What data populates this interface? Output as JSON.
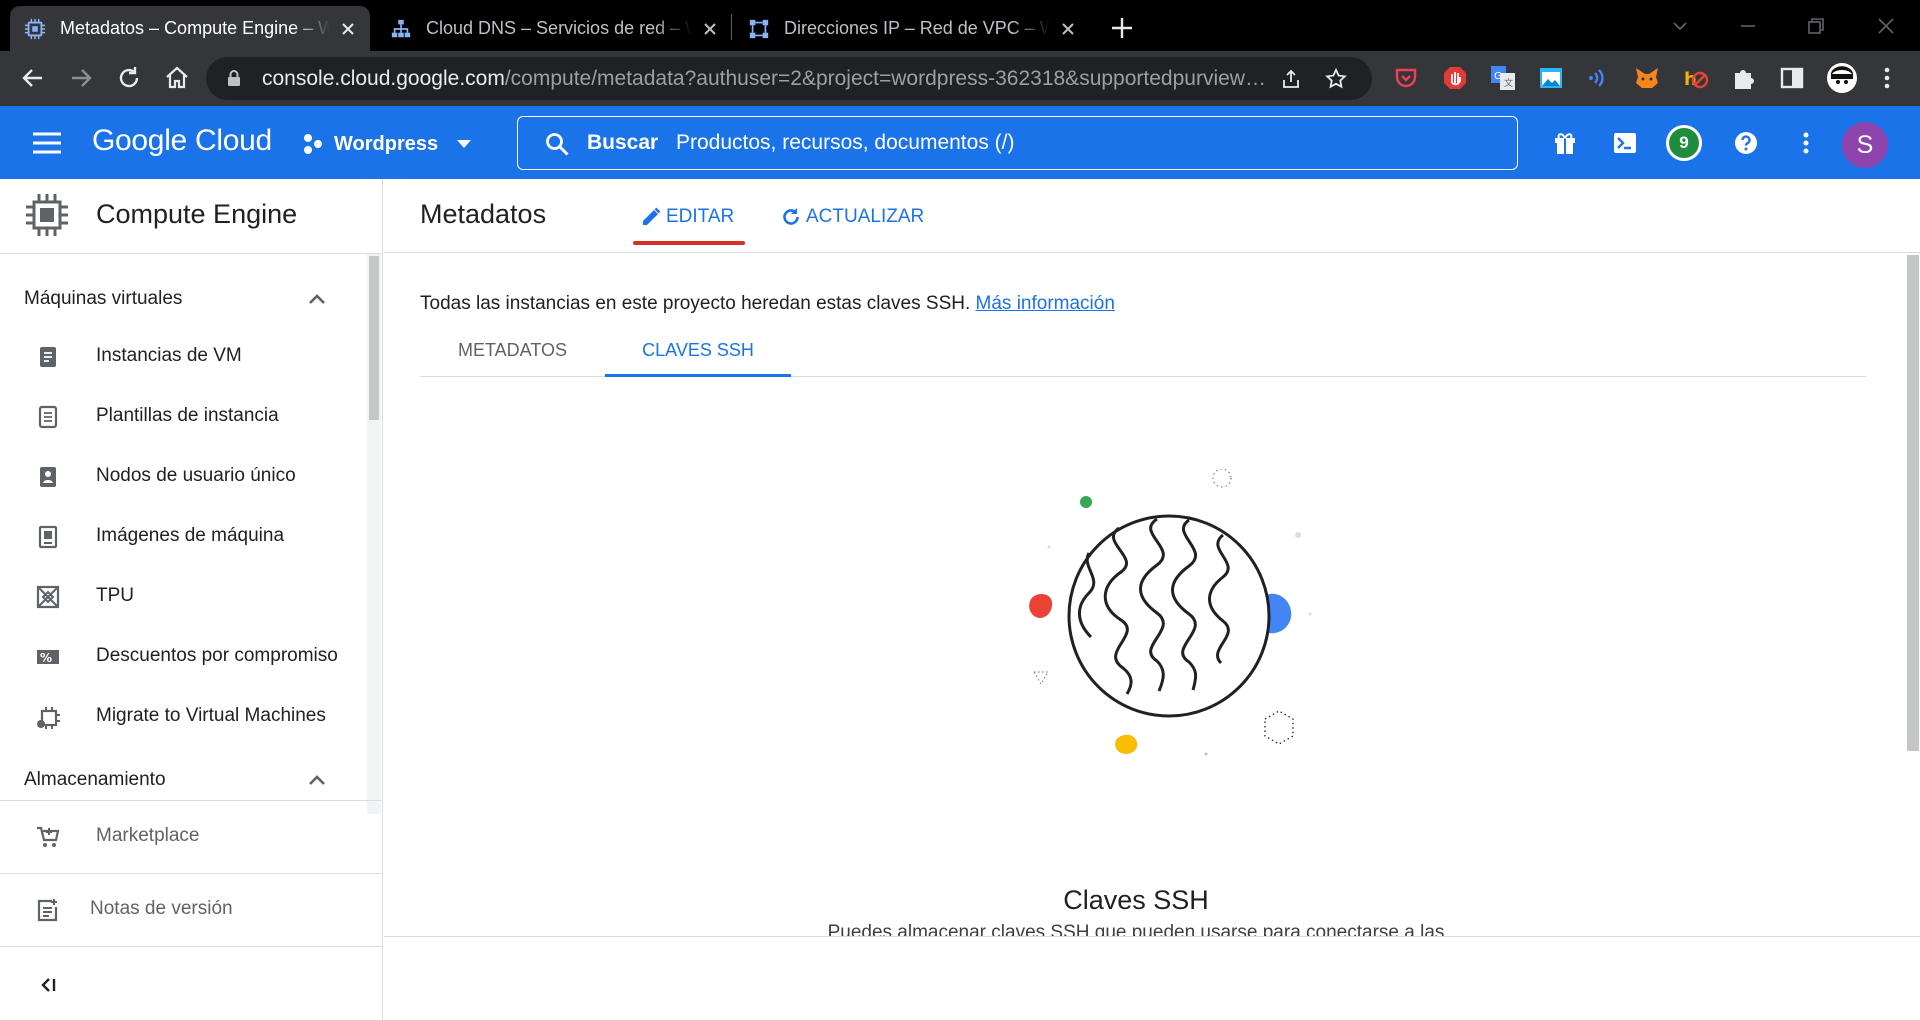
{
  "browser": {
    "tabs": [
      {
        "title": "Metadatos – Compute Engine – Wordpress",
        "active": true
      },
      {
        "title": "Cloud DNS – Servicios de red – Wordpress",
        "active": false
      },
      {
        "title": "Direcciones IP – Red de VPC – Wordpress",
        "active": false
      }
    ],
    "url_host": "console.cloud.google.com",
    "url_path": "/compute/metadata?authuser=2&project=wordpress-362318&supportedpurview=project"
  },
  "header": {
    "logo": "Google Cloud",
    "project": "Wordpress",
    "search_label": "Buscar",
    "search_placeholder": "Productos, recursos, documentos (/)",
    "notification_count": "9",
    "avatar_initial": "S",
    "brand_color": "#1a73e8"
  },
  "sidebar": {
    "product": "Compute Engine",
    "sections": [
      {
        "label": "Máquinas virtuales"
      },
      {
        "label": "Almacenamiento"
      }
    ],
    "items": [
      {
        "label": "Instancias de VM",
        "icon": "vm-instances-icon"
      },
      {
        "label": "Plantillas de instancia",
        "icon": "instance-templates-icon"
      },
      {
        "label": "Nodos de usuario único",
        "icon": "sole-tenant-nodes-icon"
      },
      {
        "label": "Imágenes de máquina",
        "icon": "machine-images-icon"
      },
      {
        "label": "TPU",
        "icon": "tpu-icon"
      },
      {
        "label": "Descuentos por compromiso",
        "icon": "percent-discount-icon"
      },
      {
        "label": "Migrate to Virtual Machines",
        "icon": "migrate-icon"
      }
    ],
    "marketplace": "Marketplace",
    "release_notes": "Notas de versión"
  },
  "main": {
    "title": "Metadatos",
    "edit_label": "EDITAR",
    "refresh_label": "ACTUALIZAR",
    "info_text": "Todas las instancias en este proyecto heredan estas claves SSH.",
    "info_link": "Más información",
    "tabs": [
      {
        "label": "METADATOS",
        "active": false
      },
      {
        "label": "CLAVES SSH",
        "active": true
      }
    ],
    "empty_title": "Claves SSH",
    "empty_subtitle": "Puedes almacenar claves SSH que pueden usarse para conectarse a las"
  }
}
